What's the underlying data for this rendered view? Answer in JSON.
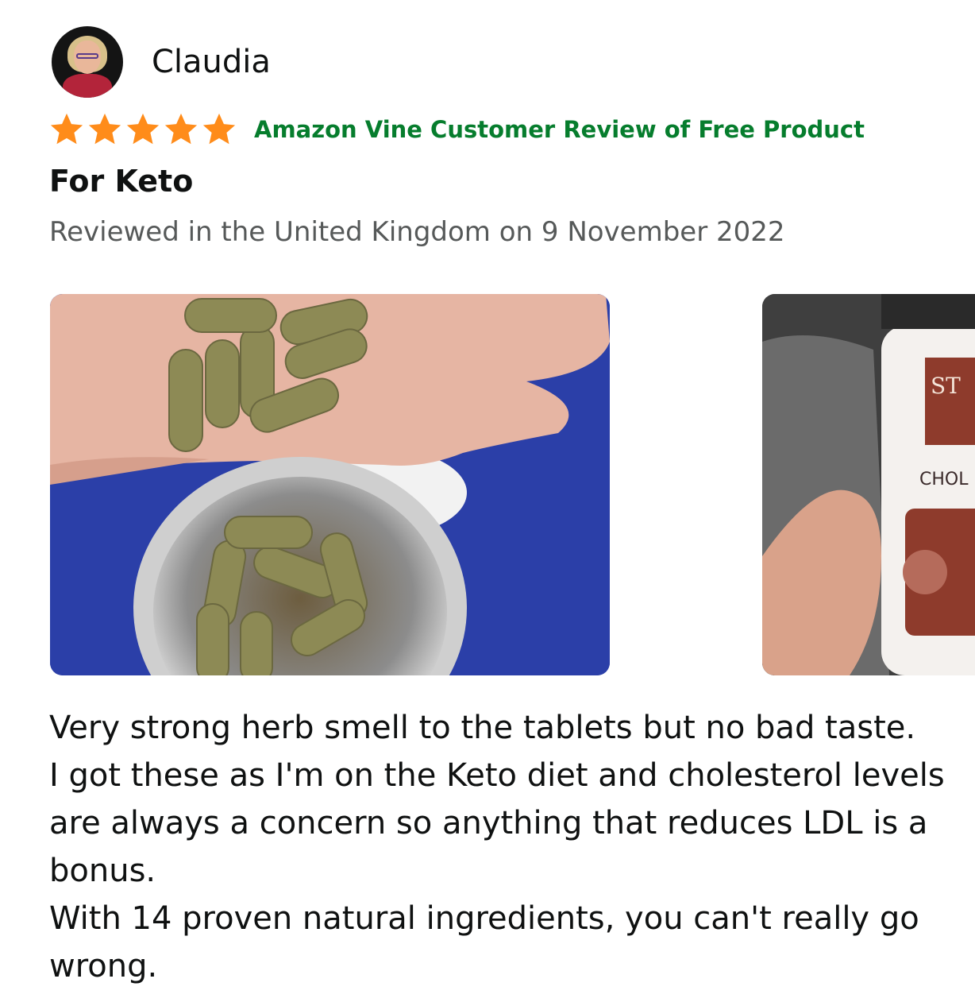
{
  "reviewer": {
    "name": "Claudia",
    "avatar_icon": "user-avatar"
  },
  "rating": {
    "stars": 5,
    "max_stars": 5,
    "star_color": "#ff8c1a",
    "vine_label": "Amazon Vine Customer Review of Free Product",
    "vine_label_color": "#067d2d"
  },
  "review": {
    "title": "For Keto",
    "meta": "Reviewed in the United Kingdom on 9 November 2022",
    "images": [
      {
        "icon": "photo-capsules-in-hand"
      },
      {
        "icon": "photo-cholesterol-bottle",
        "visible_label": "CHOL"
      }
    ],
    "body_lines": [
      "Very strong herb smell to the tablets but no bad taste.",
      "I got these as I'm on the Keto diet and cholesterol levels are always a concern so anything that reduces LDL is a bonus.",
      "With 14 proven natural ingredients, you can't really go wrong."
    ]
  }
}
